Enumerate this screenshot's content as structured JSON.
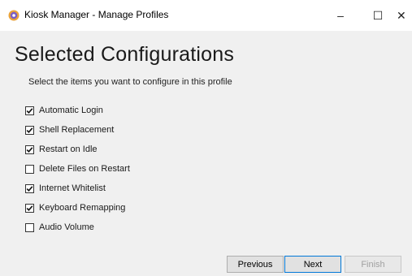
{
  "window": {
    "title": "Kiosk Manager - Manage Profiles",
    "controls": {
      "minimize": "–",
      "maximize": "☐",
      "close": "✕"
    }
  },
  "main": {
    "heading": "Selected Configurations",
    "subtitle": "Select the items you want to configure in this profile",
    "options": [
      {
        "label": "Automatic Login",
        "checked": true
      },
      {
        "label": "Shell Replacement",
        "checked": true
      },
      {
        "label": "Restart on Idle",
        "checked": true
      },
      {
        "label": "Delete Files on Restart",
        "checked": false
      },
      {
        "label": "Internet Whitelist",
        "checked": true
      },
      {
        "label": "Keyboard Remapping",
        "checked": true
      },
      {
        "label": "Audio Volume",
        "checked": false
      }
    ]
  },
  "footer": {
    "previous_label": "Previous",
    "next_label": "Next",
    "finish_label": "Finish",
    "finish_enabled": false
  }
}
